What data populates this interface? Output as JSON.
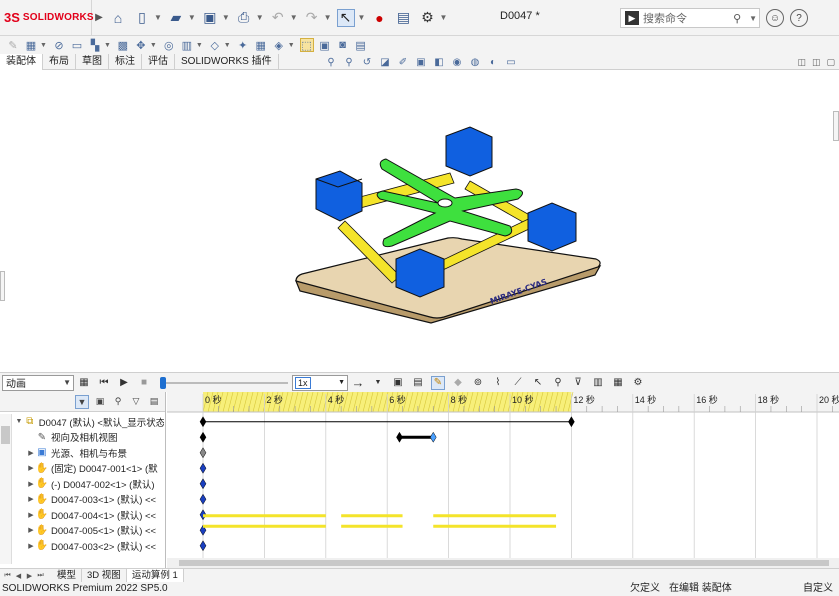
{
  "app": {
    "brand_mark": "3S",
    "brand_name": "SOLIDWORKS",
    "doc_title": "D0047 *"
  },
  "search": {
    "placeholder": "搜索命令",
    "term_glyph": "▶"
  },
  "tabs": [
    "装配体",
    "布局",
    "草图",
    "标注",
    "评估",
    "SOLIDWORKS 插件"
  ],
  "model": {
    "plate_text": "MIRAYE-CYAS",
    "colors": {
      "plate": "#e8d5b0",
      "block": "#1060e0",
      "cross": "#3ee03e",
      "rod": "#f4e42a",
      "outline": "#111111"
    }
  },
  "motion": {
    "study_type": "动画",
    "speed": "1x",
    "time_labels": [
      "0 秒",
      "2 秒",
      "4 秒",
      "6 秒",
      "8 秒",
      "10 秒",
      "12 秒",
      "14 秒",
      "16 秒",
      "18 秒",
      "20 秒"
    ],
    "tree": [
      "D0047 (默认) <默认_显示状态",
      "视向及相机视图",
      "光源、相机与布景",
      "(固定) D0047-001<1> (默",
      "(-) D0047-002<1> (默认)",
      "D0047-003<1> (默认) <<",
      "D0047-004<1> (默认) <<",
      "D0047-005<1> (默认) <<",
      "D0047-003<2> (默认) <<"
    ]
  },
  "bottom_tabs": [
    "模型",
    "3D 视图",
    "运动算例 1"
  ],
  "status": {
    "product": "SOLIDWORKS Premium 2022 SP5.0",
    "definition": "欠定义",
    "mode": "在编辑 装配体",
    "custom": "自定义"
  }
}
